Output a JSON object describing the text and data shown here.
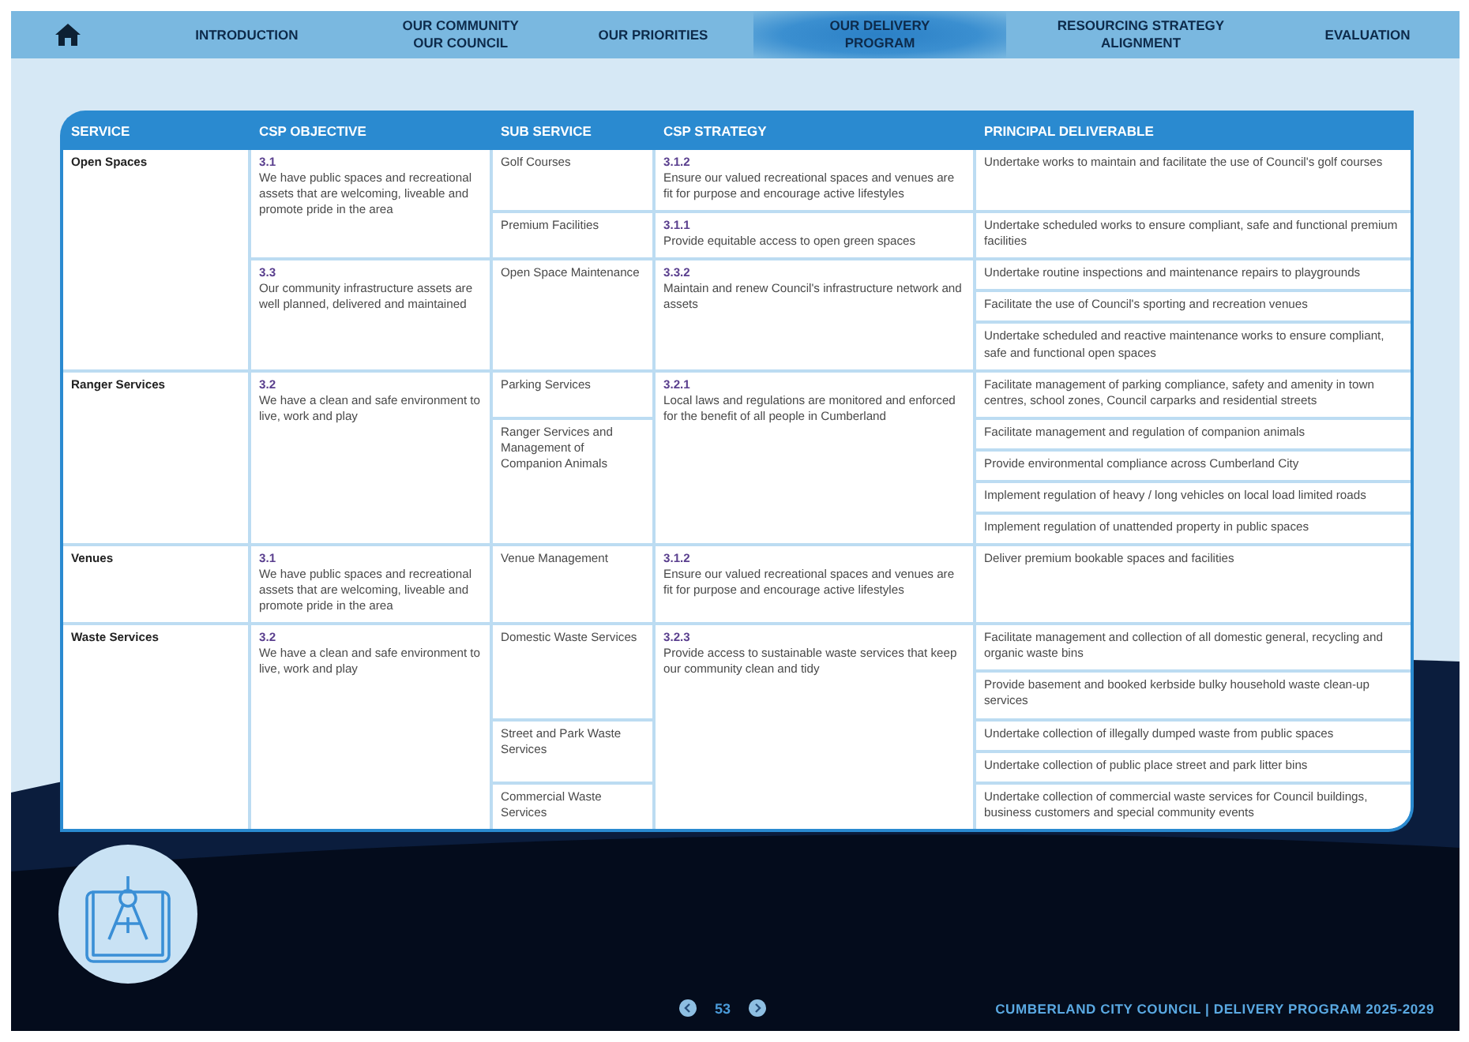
{
  "nav": {
    "tabs": [
      {
        "label": "INTRODUCTION",
        "selected": false
      },
      {
        "label": "OUR COMMUNITY\nOUR COUNCIL",
        "selected": false
      },
      {
        "label": "OUR PRIORITIES",
        "selected": false
      },
      {
        "label": "OUR DELIVERY\nPROGRAM",
        "selected": true
      },
      {
        "label": "RESOURCING STRATEGY\nALIGNMENT",
        "selected": false
      },
      {
        "label": "EVALUATION",
        "selected": false
      }
    ]
  },
  "table": {
    "columns": [
      "SERVICE",
      "CSP OBJECTIVE",
      "SUB SERVICE",
      "CSP STRATEGY",
      "PRINCIPAL DELIVERABLE"
    ],
    "services": [
      {
        "name": "Open Spaces",
        "objectives": [
          {
            "code": "3.1",
            "text": "We have public spaces and recreational assets that are welcoming, liveable and promote pride in the area",
            "strategies": [
              {
                "code": "3.1.2",
                "text": "Ensure our valued recreational spaces and venues are fit for purpose and encourage active lifestyles",
                "sub_services": [
                  {
                    "name": "Golf Courses",
                    "deliverables": [
                      "Undertake works to maintain and facilitate the use of Council's golf courses"
                    ]
                  }
                ]
              },
              {
                "code": "3.1.1",
                "text": "Provide equitable access to open green spaces",
                "sub_services": [
                  {
                    "name": "Premium Facilities",
                    "deliverables": [
                      "Undertake scheduled works to ensure compliant, safe and functional premium facilities"
                    ]
                  }
                ]
              }
            ]
          },
          {
            "code": "3.3",
            "text": "Our community infrastructure assets are well planned, delivered and maintained",
            "strategies": [
              {
                "code": "3.3.2",
                "text": "Maintain and renew Council's infrastructure network and assets",
                "sub_services": [
                  {
                    "name": "Open Space Maintenance",
                    "deliverables": [
                      "Undertake routine inspections and maintenance repairs to playgrounds",
                      "Facilitate the use of Council's sporting and recreation venues",
                      "Undertake scheduled and reactive maintenance works to ensure compliant, safe and functional open spaces"
                    ]
                  }
                ]
              }
            ]
          }
        ]
      },
      {
        "name": "Ranger Services",
        "objectives": [
          {
            "code": "3.2",
            "text": "We have a clean and safe environment to live, work and play",
            "strategies": [
              {
                "code": "3.2.1",
                "text": "Local laws and regulations are monitored and enforced for the benefit of all people in Cumberland",
                "sub_services": [
                  {
                    "name": "Parking Services",
                    "deliverables": [
                      "Facilitate management of parking compliance, safety and amenity in town centres, school zones, Council carparks and residential streets"
                    ]
                  },
                  {
                    "name": "Ranger Services and Management of Companion Animals",
                    "deliverables": [
                      "Facilitate management and regulation of companion animals",
                      "Provide environmental compliance across Cumberland City",
                      "Implement regulation of heavy / long vehicles on local load limited roads",
                      "Implement regulation of unattended property in public spaces"
                    ]
                  }
                ]
              }
            ]
          }
        ]
      },
      {
        "name": "Venues",
        "objectives": [
          {
            "code": "3.1",
            "text": "We have public spaces and recreational assets that are welcoming, liveable and promote pride in the area",
            "strategies": [
              {
                "code": "3.1.2",
                "text": "Ensure our valued recreational spaces and venues are fit for purpose and encourage active lifestyles",
                "sub_services": [
                  {
                    "name": "Venue Management",
                    "deliverables": [
                      "Deliver premium bookable spaces and facilities"
                    ]
                  }
                ]
              }
            ]
          }
        ]
      },
      {
        "name": "Waste Services",
        "objectives": [
          {
            "code": "3.2",
            "text": "We have a clean and safe environment to live, work and play",
            "strategies": [
              {
                "code": "3.2.3",
                "text": "Provide access to sustainable waste services that keep our community clean and tidy",
                "sub_services": [
                  {
                    "name": "Domestic Waste Services",
                    "deliverables": [
                      "Facilitate management and collection of all domestic general, recycling and organic waste bins",
                      "Provide basement and booked kerbside bulky household waste clean-up services"
                    ]
                  },
                  {
                    "name": "Street and Park Waste Services",
                    "deliverables": [
                      "Undertake collection of illegally dumped waste from public spaces",
                      "Undertake collection of public place street and park litter bins"
                    ]
                  },
                  {
                    "name": "Commercial Waste Services",
                    "deliverables": [
                      "Undertake collection of commercial waste services for Council buildings, business customers and special community events"
                    ]
                  }
                ]
              }
            ]
          }
        ]
      }
    ]
  },
  "footer": {
    "page": "53",
    "title": "CUMBERLAND CITY COUNCIL | DELIVERY PROGRAM 2025-2029"
  }
}
